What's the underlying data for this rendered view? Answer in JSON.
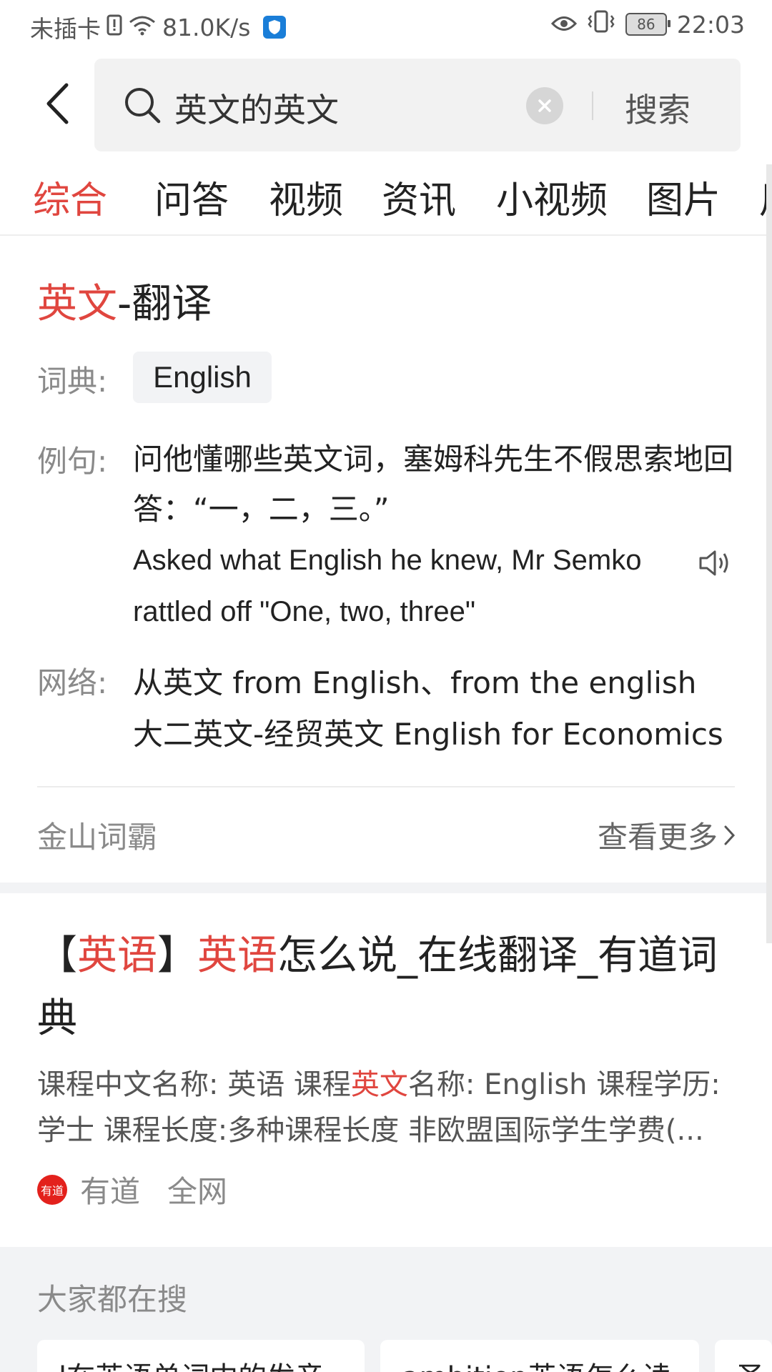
{
  "status_bar": {
    "carrier": "未插卡",
    "speed": "81.0K/s",
    "battery": "86",
    "time": "22:03"
  },
  "search": {
    "query": "英文的英文",
    "button_label": "搜索"
  },
  "tabs": [
    {
      "label": "综合",
      "active": true
    },
    {
      "label": "问答",
      "active": false
    },
    {
      "label": "视频",
      "active": false
    },
    {
      "label": "资讯",
      "active": false
    },
    {
      "label": "小视频",
      "active": false
    },
    {
      "label": "图片",
      "active": false
    },
    {
      "label": "用",
      "active": false
    }
  ],
  "dictionary": {
    "title_highlight": "英文",
    "title_rest": "-翻译",
    "dict_label": "词典:",
    "dict_value": "English",
    "example_label": "例句:",
    "example_cn": "问他懂哪些英文词，塞姆科先生不假思索地回答：“一，二，三。”",
    "example_en": "Asked what English he knew, Mr Semko rattled off \"One, two, three\"",
    "network_label": "网络:",
    "network_lines": [
      "从英文 from English、from the english",
      "大二英文-经贸英文 English for Economics"
    ],
    "source": "金山词霸",
    "more": "查看更多"
  },
  "result": {
    "title_parts": [
      "【",
      "英语",
      "】",
      "英语",
      "怎么说_在线翻译_有道词典"
    ],
    "snippet_parts": [
      "课程中文名称: 英语 课程",
      "英文",
      "名称: English 课程学历: 学士 课程长度:多种课程长度 非欧盟国际学生学费(..."
    ],
    "source_logo": "有道",
    "source_name": "有道",
    "source_scope": "全网"
  },
  "hot": {
    "title": "大家都在搜",
    "chips": [
      "l在英语单词中的发音",
      "ambition英语怎么读",
      "圣"
    ]
  },
  "colors": {
    "accent": "#e0463f",
    "gray_bg": "#f2f3f5"
  }
}
